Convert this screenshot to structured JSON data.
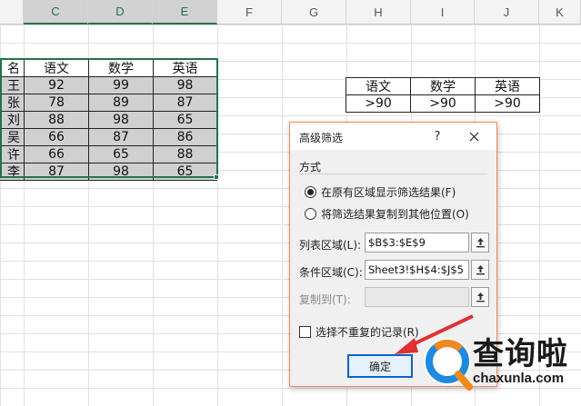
{
  "columns": [
    "C",
    "D",
    "E",
    "F",
    "G",
    "H",
    "I",
    "J",
    "K"
  ],
  "table": {
    "headers": [
      "名",
      "语文",
      "数学",
      "英语"
    ],
    "rows": [
      [
        "王",
        "92",
        "99",
        "98"
      ],
      [
        "张",
        "78",
        "89",
        "87"
      ],
      [
        "刘",
        "88",
        "98",
        "65"
      ],
      [
        "吴",
        "66",
        "87",
        "86"
      ],
      [
        "许",
        "66",
        "65",
        "88"
      ],
      [
        "李",
        "87",
        "98",
        "65"
      ]
    ]
  },
  "criteria": {
    "headers": [
      "语文",
      "数学",
      "英语"
    ],
    "values": [
      ">90",
      ">90",
      ">90"
    ]
  },
  "dialog": {
    "title": "高级筛选",
    "help": "?",
    "section": "方式",
    "option1": "在原有区域显示筛选结果(F)",
    "option2": "将筛选结果复制到其他位置(O)",
    "list_label": "列表区域(L):",
    "list_value": "$B$3:$E$9",
    "criteria_label": "条件区域(C):",
    "criteria_value": "Sheet3!$H$4:$J$5",
    "copy_label": "复制到(T):",
    "copy_value": "",
    "unique_label": "选择不重复的记录(R)",
    "ok_label": "确定"
  },
  "watermark": {
    "text": "查询啦",
    "sub": "chaxunla.com"
  },
  "colors": {
    "excel_green": "#217346",
    "dialog_border": "#ef8a5a",
    "ok_border": "#0a64c8",
    "arrow_red": "#e03030"
  }
}
